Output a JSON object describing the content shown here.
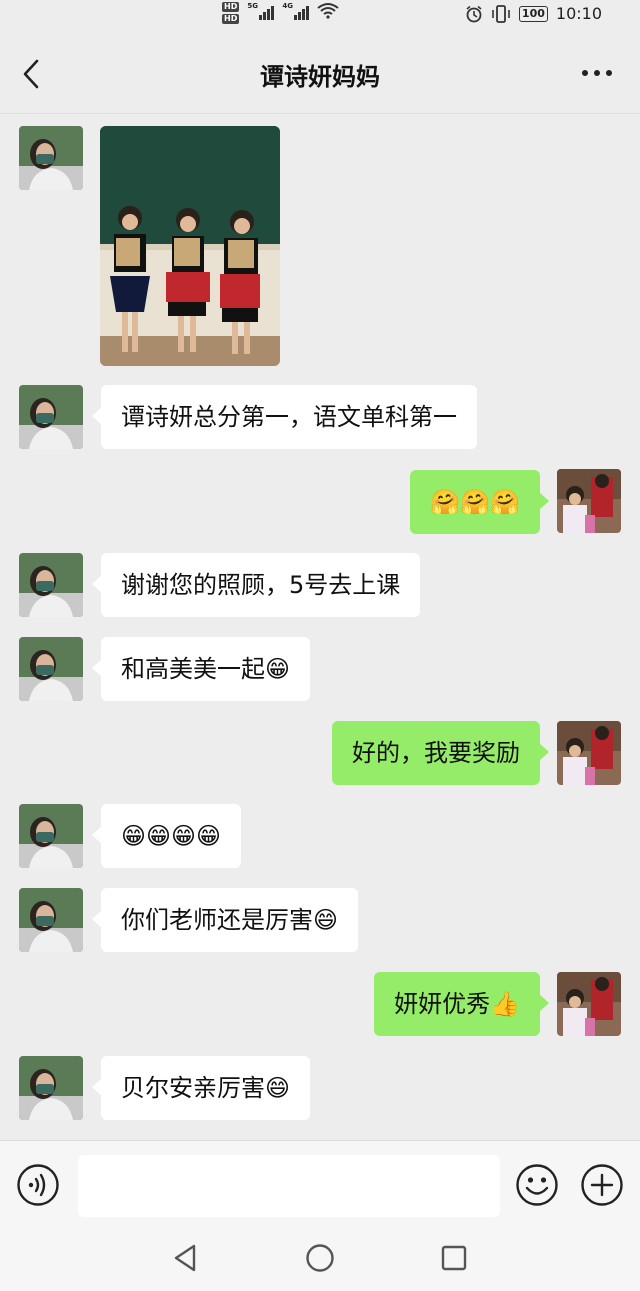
{
  "status_bar": {
    "hd1": "HD",
    "hd2": "HD",
    "net1": "5G",
    "net2": "4G",
    "battery": "100",
    "time": "10:10"
  },
  "header": {
    "title": "谭诗妍妈妈",
    "back_icon": "chevron-left-icon",
    "more_icon": "more-dots-icon"
  },
  "messages": [
    {
      "sender": "contact",
      "type": "image",
      "alt": ""
    },
    {
      "sender": "contact",
      "type": "text",
      "text": "谭诗妍总分第一，语文单科第一"
    },
    {
      "sender": "me",
      "type": "text",
      "text": "🤗🤗🤗"
    },
    {
      "sender": "contact",
      "type": "text",
      "text": "谢谢您的照顾，5号去上课"
    },
    {
      "sender": "contact",
      "type": "text",
      "text": "和高美美一起😁"
    },
    {
      "sender": "me",
      "type": "text",
      "text": "好的，我要奖励"
    },
    {
      "sender": "contact",
      "type": "text",
      "text": "😁😁😁😁"
    },
    {
      "sender": "contact",
      "type": "text",
      "text": "你们老师还是厉害😄"
    },
    {
      "sender": "me",
      "type": "text",
      "text": "妍妍优秀👍"
    },
    {
      "sender": "contact",
      "type": "text",
      "text": "贝尔安亲厉害😄"
    }
  ],
  "input_bar": {
    "placeholder": "",
    "voice_icon": "voice-icon",
    "emoji_icon": "smile-icon",
    "plus_icon": "plus-icon"
  },
  "colors": {
    "background": "#ededed",
    "incoming_bubble": "#ffffff",
    "outgoing_bubble": "#95ec69",
    "board_green": "#1f4a3c"
  }
}
